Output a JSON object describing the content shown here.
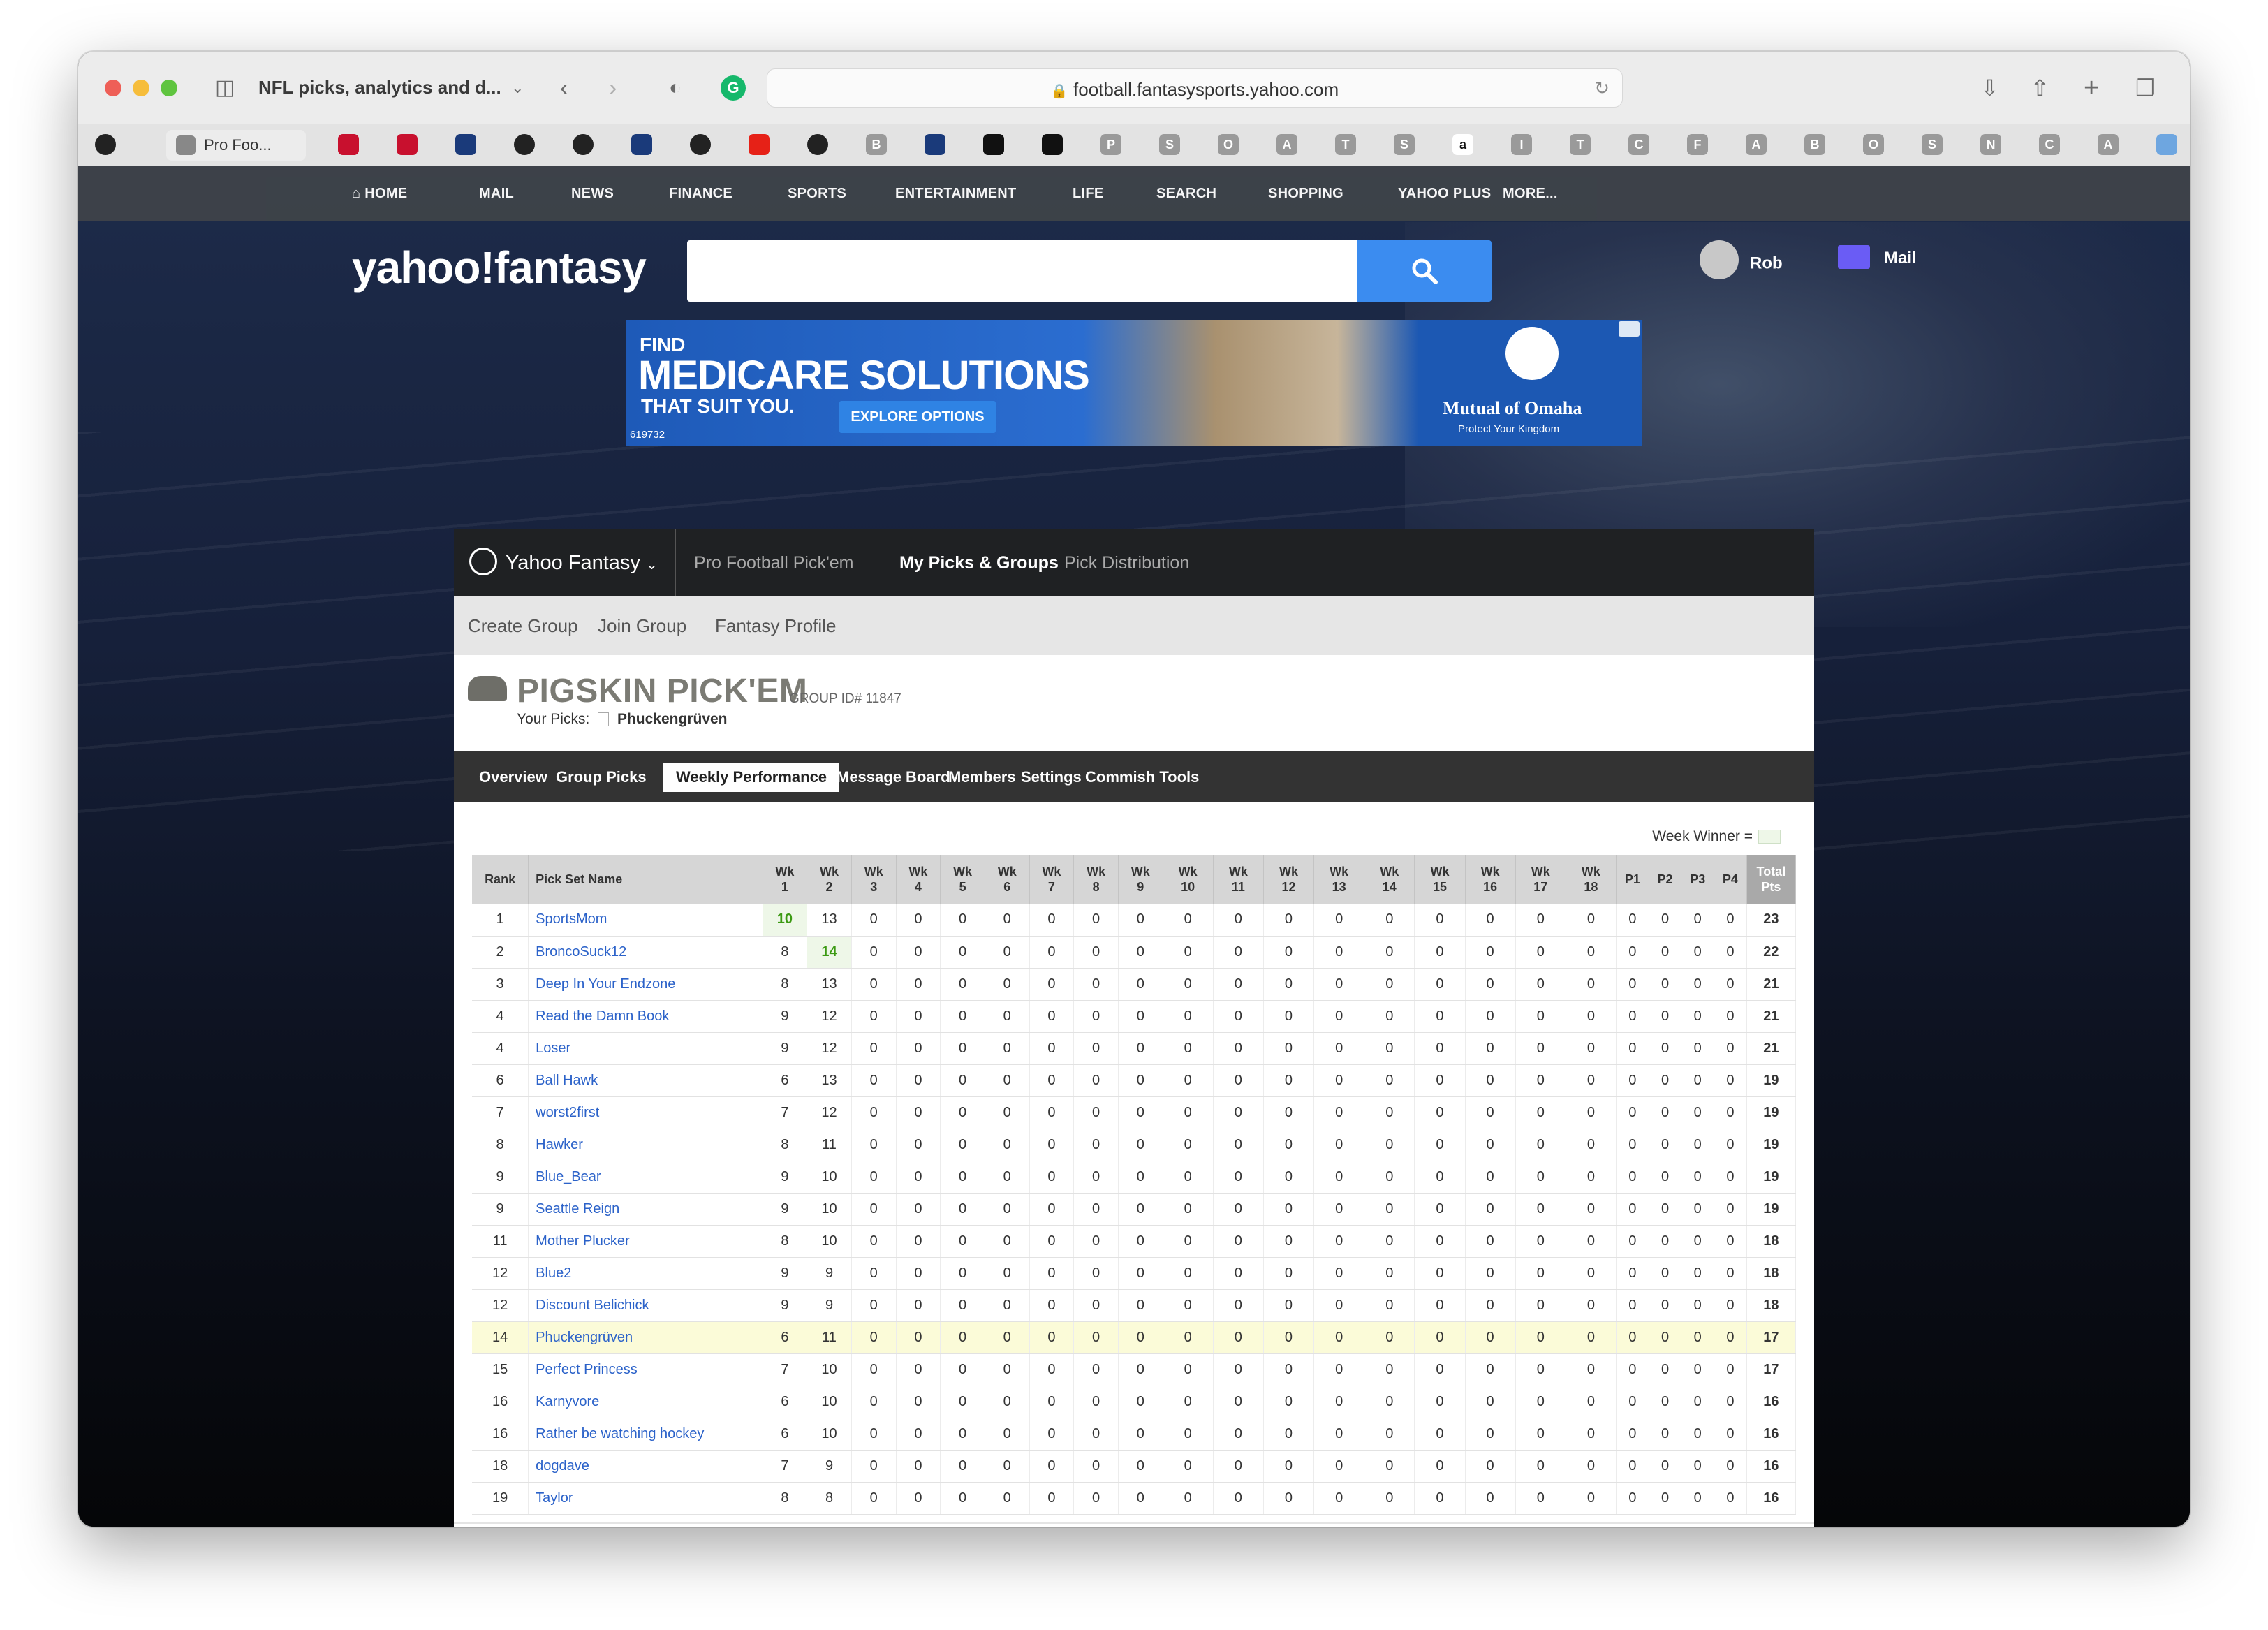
{
  "browser": {
    "tab_title": "NFL picks, analytics and d...",
    "url": "football.fantasysports.yahoo.com",
    "fav_tab_label": "Pro Foo...",
    "favorites": [
      "github",
      "ybox",
      "espn",
      "espn",
      "nfl",
      "github",
      "github",
      "nfl",
      "github",
      "youtube",
      "github",
      "B",
      "nfl",
      "dot",
      "dot",
      "P",
      "S",
      "O",
      "A",
      "T",
      "S",
      "a",
      "I",
      "T",
      "C",
      "F",
      "A",
      "B",
      "O",
      "S",
      "N",
      "C",
      "A",
      "gear"
    ]
  },
  "yahoo_nav": {
    "items": [
      "HOME",
      "MAIL",
      "NEWS",
      "FINANCE",
      "SPORTS",
      "ENTERTAINMENT",
      "LIFE",
      "SEARCH",
      "SHOPPING",
      "YAHOO PLUS",
      "MORE..."
    ]
  },
  "header": {
    "logo": "yahoo!fantasy",
    "user_name": "Rob",
    "mail_label": "Mail"
  },
  "ad": {
    "line1": "FIND",
    "line2": "MEDICARE SOLUTIONS",
    "line3": "THAT SUIT YOU.",
    "button": "EXPLORE OPTIONS",
    "code": "619732",
    "brand": "Mutual of Omaha",
    "tagline": "Protect Your Kingdom"
  },
  "fantasy_nav": {
    "brand": "Yahoo Fantasy",
    "links": [
      "Pro Football Pick'em",
      "My Picks & Groups",
      "Pick Distribution"
    ],
    "sub_links": [
      "Create Group",
      "Join Group",
      "Fantasy Profile"
    ]
  },
  "group": {
    "name": "PIGSKIN PICK'EM",
    "id_label": "GROUP ID# 11847",
    "your_picks_label": "Your Picks:",
    "your_picks_name": "Phuckengrüven",
    "tabs": [
      "Overview",
      "Group Picks",
      "Weekly Performance",
      "Message Board",
      "Members",
      "Settings",
      "Commish Tools"
    ],
    "active_tab": "Weekly Performance"
  },
  "legend": {
    "week_winner": "Week Winner ="
  },
  "table": {
    "headers": [
      "Rank",
      "Pick Set Name",
      "Wk\n1",
      "Wk\n2",
      "Wk\n3",
      "Wk\n4",
      "Wk\n5",
      "Wk\n6",
      "Wk\n7",
      "Wk\n8",
      "Wk\n9",
      "Wk\n10",
      "Wk\n11",
      "Wk\n12",
      "Wk\n13",
      "Wk\n14",
      "Wk\n15",
      "Wk\n16",
      "Wk\n17",
      "Wk\n18",
      "P1",
      "P2",
      "P3",
      "P4",
      "Total\nPts"
    ],
    "rows": [
      {
        "rank": "1",
        "name": "SportsMom",
        "wk1": "10",
        "wk2": "13",
        "total": "23",
        "win": 1
      },
      {
        "rank": "2",
        "name": "BroncoSuck12",
        "wk1": "8",
        "wk2": "14",
        "total": "22",
        "win": 2
      },
      {
        "rank": "3",
        "name": "Deep In Your Endzone",
        "wk1": "8",
        "wk2": "13",
        "total": "21"
      },
      {
        "rank": "4",
        "name": "Read the Damn Book",
        "wk1": "9",
        "wk2": "12",
        "total": "21"
      },
      {
        "rank": "4",
        "name": "Loser",
        "wk1": "9",
        "wk2": "12",
        "total": "21"
      },
      {
        "rank": "6",
        "name": "Ball Hawk",
        "wk1": "6",
        "wk2": "13",
        "total": "19"
      },
      {
        "rank": "7",
        "name": "worst2first",
        "wk1": "7",
        "wk2": "12",
        "total": "19"
      },
      {
        "rank": "8",
        "name": "Hawker",
        "wk1": "8",
        "wk2": "11",
        "total": "19"
      },
      {
        "rank": "9",
        "name": "Blue_Bear",
        "wk1": "9",
        "wk2": "10",
        "total": "19"
      },
      {
        "rank": "9",
        "name": "Seattle Reign",
        "wk1": "9",
        "wk2": "10",
        "total": "19"
      },
      {
        "rank": "11",
        "name": "Mother Plucker",
        "wk1": "8",
        "wk2": "10",
        "total": "18"
      },
      {
        "rank": "12",
        "name": "Blue2",
        "wk1": "9",
        "wk2": "9",
        "total": "18"
      },
      {
        "rank": "12",
        "name": "Discount Belichick",
        "wk1": "9",
        "wk2": "9",
        "total": "18"
      },
      {
        "rank": "14",
        "name": "Phuckengrüven",
        "wk1": "6",
        "wk2": "11",
        "total": "17",
        "me": true
      },
      {
        "rank": "15",
        "name": "Perfect Princess",
        "wk1": "7",
        "wk2": "10",
        "total": "17"
      },
      {
        "rank": "16",
        "name": "Karnyvore",
        "wk1": "6",
        "wk2": "10",
        "total": "16"
      },
      {
        "rank": "16",
        "name": "Rather be watching hockey",
        "wk1": "6",
        "wk2": "10",
        "total": "16"
      },
      {
        "rank": "18",
        "name": "dogdave",
        "wk1": "7",
        "wk2": "9",
        "total": "16"
      },
      {
        "rank": "19",
        "name": "Taylor",
        "wk1": "8",
        "wk2": "8",
        "total": "16"
      }
    ],
    "zero": "0"
  },
  "colors": {
    "yahoo_blue": "#3b8cf0",
    "win_green": "#3c9a13",
    "link": "#2b62c9",
    "highlight": "#fbfbd8"
  }
}
